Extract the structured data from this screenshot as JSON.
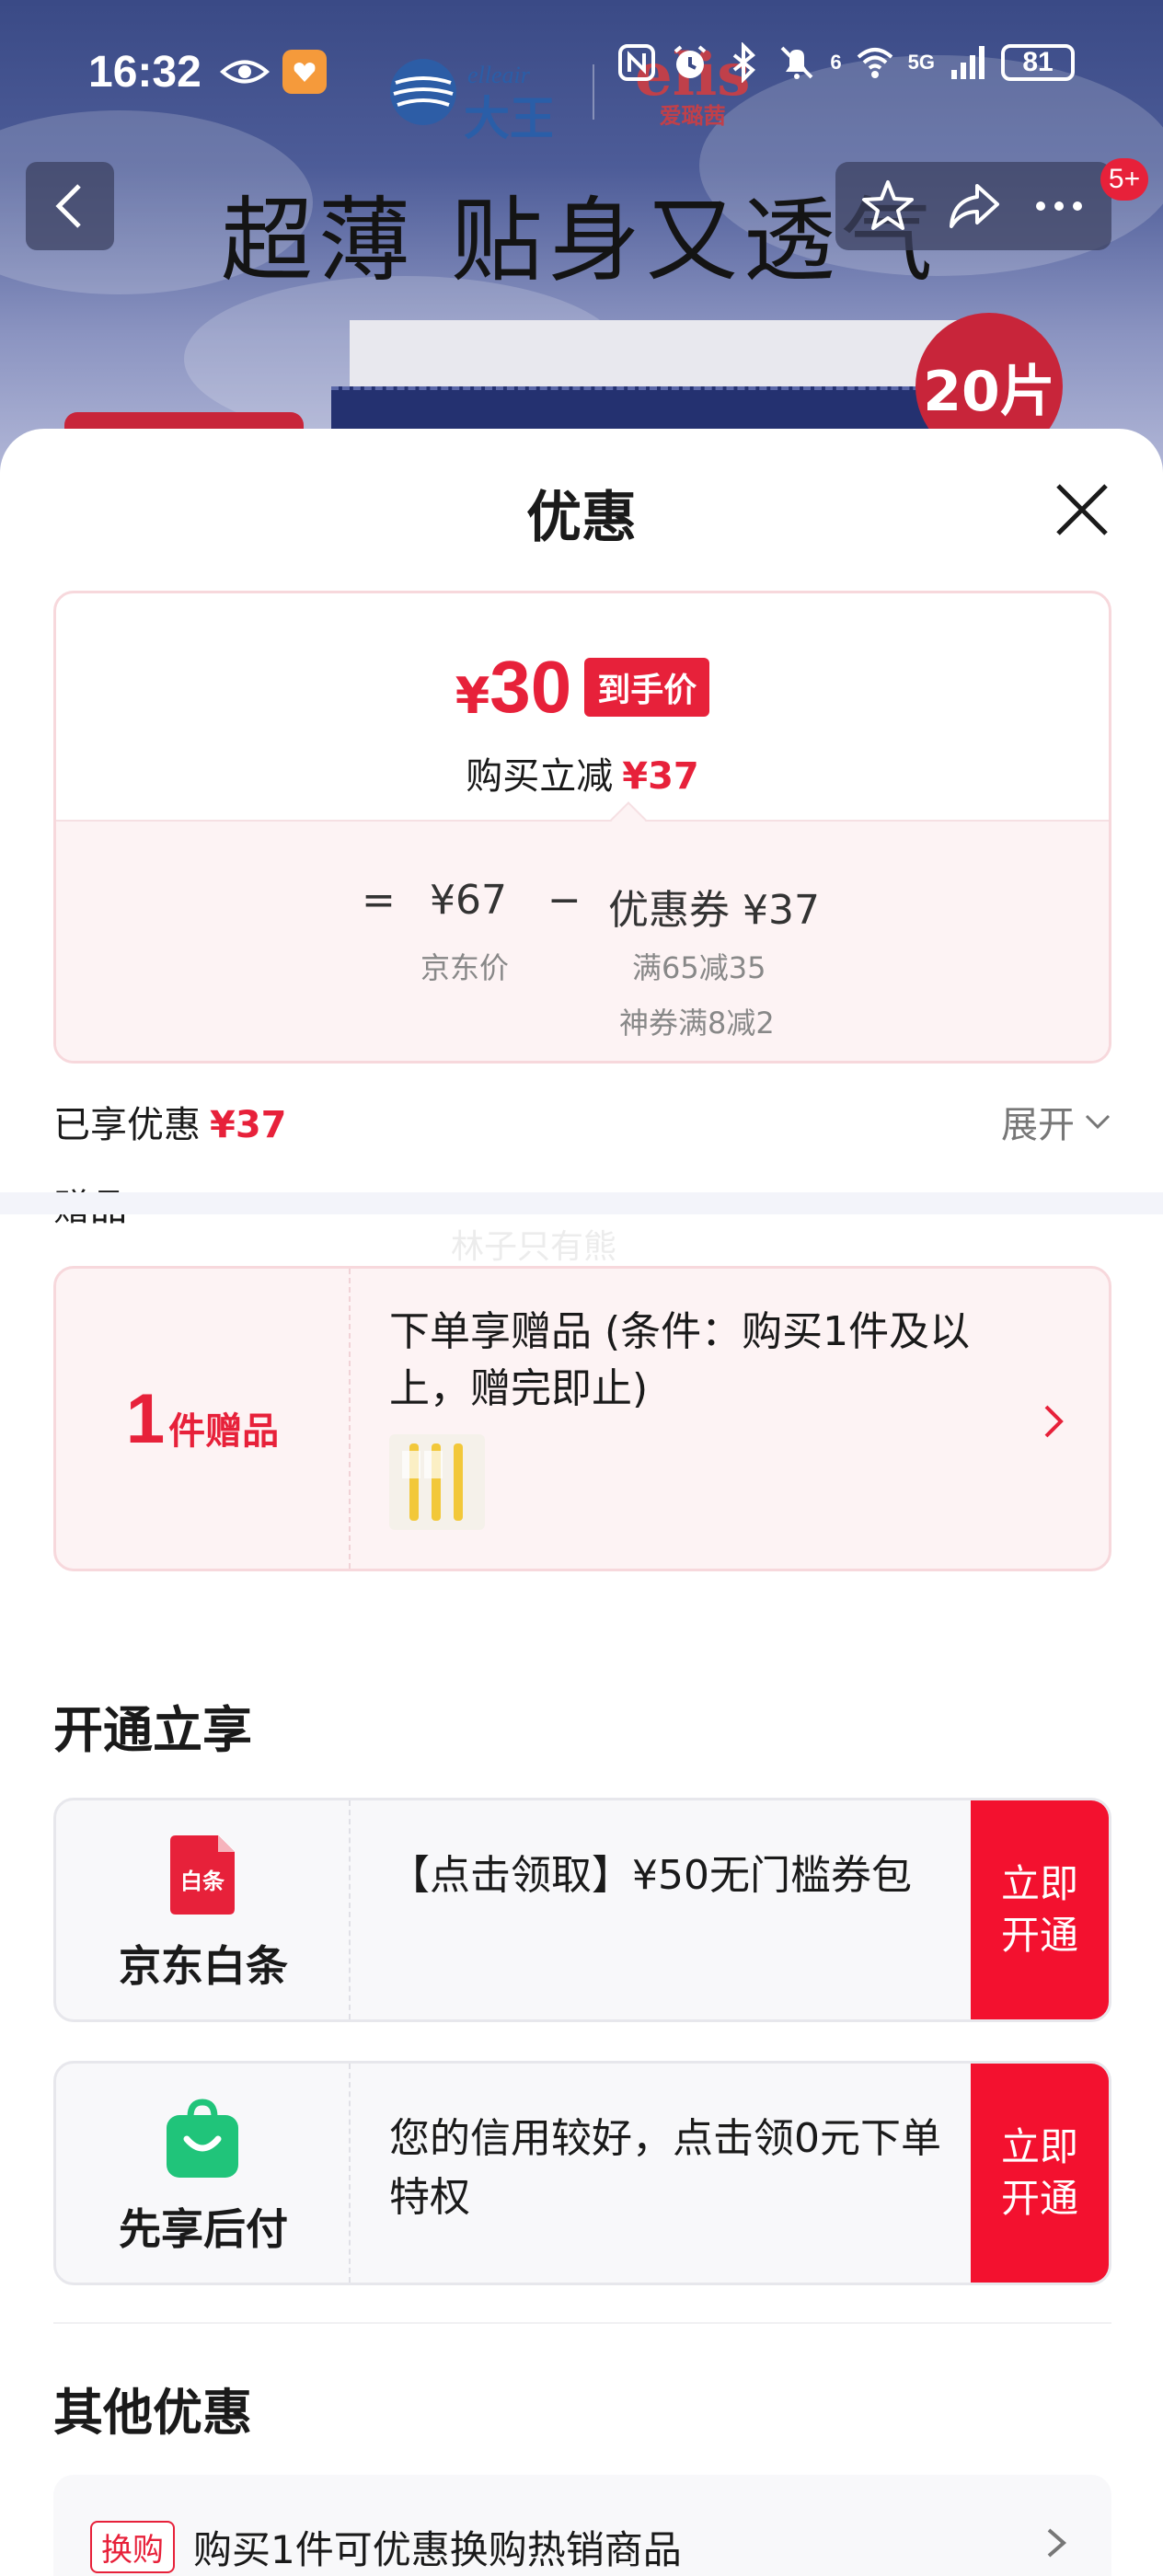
{
  "status_bar": {
    "time": "16:32",
    "network": "5G",
    "wifi_label": "6",
    "battery": "81"
  },
  "product_banner": {
    "headline": "超薄 贴身又透气",
    "brand1": "大王",
    "brand1_en": "elleair",
    "brand2": "elis",
    "brand2_sub": "爱璐茜",
    "pieces_badge": "20片"
  },
  "nav": {
    "message_badge": "5+"
  },
  "sheet": {
    "title": "优惠"
  },
  "price_card": {
    "currency": "¥",
    "final_price": "30",
    "final_tag": "到手价",
    "instant_discount_label": "购买立减",
    "instant_discount_value": "¥37",
    "equals": "=",
    "jd_price": "¥67",
    "minus": "−",
    "coupon_label": "优惠券 ¥37",
    "jd_price_label": "京东价",
    "coupon_note_1": "满65减35",
    "coupon_note_2": "神券满8减2"
  },
  "benefit": {
    "label": "已享优惠",
    "value": "¥37",
    "expand_label": "展开"
  },
  "gift": {
    "section_label": "赠品",
    "watermark": "林子只有熊",
    "count": "1",
    "unit": "件赠品",
    "description": "下单享赠品 (条件：购买1件及以上，赠完即止)"
  },
  "open_section": {
    "title": "开通立享",
    "items": [
      {
        "name": "京东白条",
        "icon_text": "白条",
        "description": "【点击领取】¥50无门槛券包",
        "button": "立即开通"
      },
      {
        "name": "先享后付",
        "description": "您的信用较好，点击领0元下单特权",
        "button": "立即开通"
      }
    ]
  },
  "other_section": {
    "title": "其他优惠",
    "swap_tag": "换购",
    "swap_text": "购买1件可优惠换购热销商品"
  },
  "colors": {
    "accent_red": "#e7213a",
    "button_red": "#f3112f",
    "baitiao_red": "#e7213a",
    "pay_later_green": "#20c47a"
  }
}
